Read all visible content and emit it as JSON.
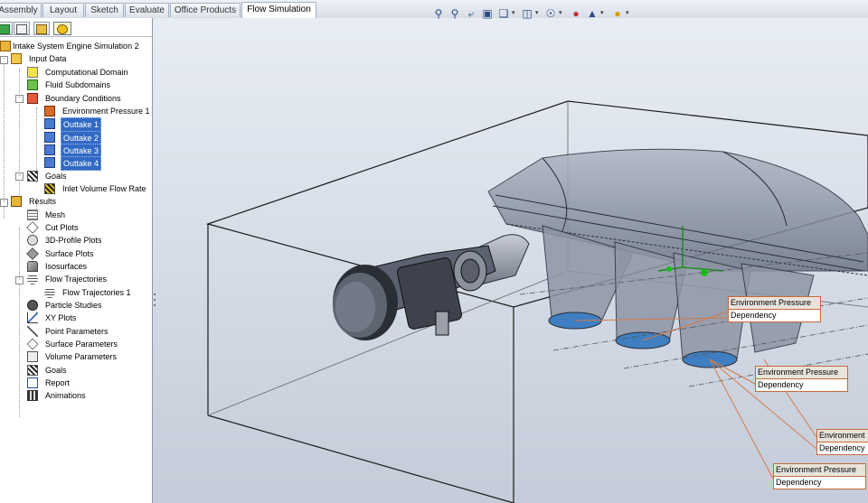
{
  "tabs": [
    "Assembly",
    "Layout",
    "Sketch",
    "Evaluate",
    "Office Products",
    "Flow Simulation"
  ],
  "active_tab": "Flow Simulation",
  "toolbar_icons": [
    "zoom-to-fit-icon",
    "zoom-area-icon",
    "previous-view-icon",
    "section-view-icon",
    "view-orientation-icon",
    "display-style-icon",
    "hide-show-icon",
    "edit-appearance-icon",
    "apply-scene-icon",
    "view-settings-icon"
  ],
  "tree": {
    "root": "Intake System Engine Simulation 2",
    "input_data": "Input Data",
    "computational_domain": "Computational Domain",
    "fluid_subdomains": "Fluid Subdomains",
    "boundary_conditions": "Boundary Conditions",
    "environment_pressure_1": "Environment Pressure 1",
    "outtake_1": "Outtake 1",
    "outtake_2": "Outtake 2",
    "outtake_3": "Outtake 3",
    "outtake_4": "Outtake 4",
    "goals": "Goals",
    "inlet_volume_flow_rate": "Inlet Volume Flow Rate",
    "results": "Results",
    "mesh": "Mesh",
    "cut_plots": "Cut Plots",
    "profile_plots": "3D-Profile Plots",
    "surface_plots": "Surface Plots",
    "isosurfaces": "Isosurfaces",
    "flow_trajectories": "Flow Trajectories",
    "flow_trajectories_1": "Flow Trajectories 1",
    "particle_studies": "Particle Studies",
    "xy_plots": "XY Plots",
    "point_parameters": "Point Parameters",
    "surface_parameters": "Surface Parameters",
    "volume_parameters": "Volume Parameters",
    "results_goals": "Goals",
    "report": "Report",
    "animations": "Animations"
  },
  "callouts": [
    {
      "title": "Environment Pressure",
      "value": "Dependency"
    },
    {
      "title": "Environment Pressure",
      "value": "Dependency"
    },
    {
      "title": "Environment",
      "value": "Dependency"
    },
    {
      "title": "Environment Pressure",
      "value": "Dependency"
    }
  ],
  "colors": {
    "selection": "#316ac5",
    "callout_border": "#c86a3a",
    "outlet_fill": "#3f7ec0"
  }
}
